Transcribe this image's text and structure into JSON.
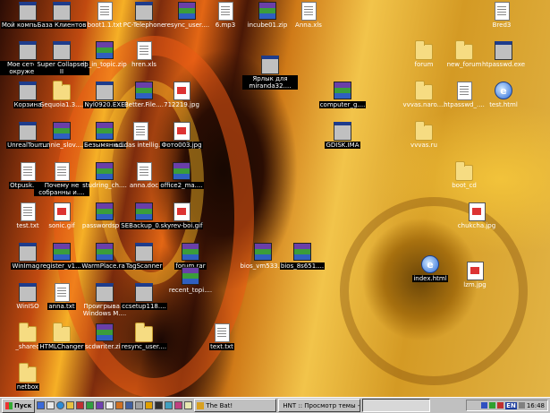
{
  "desktop": {
    "icons": [
      {
        "label": "Мой компьютер",
        "kind": "exe",
        "icon": "my-computer-icon"
      },
      {
        "label": "База Клиентов",
        "kind": "exe",
        "icon": "people-icon"
      },
      {
        "label": "boot1.1.txt",
        "kind": "doc",
        "icon": "text-file-icon"
      },
      {
        "label": "PC-Telephone",
        "kind": "exe",
        "icon": "phone-app-icon"
      },
      {
        "label": "resync_user....",
        "kind": "rar",
        "icon": "rar-archive-icon"
      },
      {
        "label": "6.mp3",
        "kind": "doc",
        "icon": "audio-file-icon"
      },
      {
        "label": "incube01.zip",
        "kind": "rar",
        "icon": "zip-archive-icon"
      },
      {
        "label": "Anna.xls",
        "kind": "doc",
        "icon": "excel-file-icon"
      },
      {
        "label": "Bred3",
        "kind": "doc",
        "icon": "document-icon"
      },
      {
        "label": "Мое сетевое окружение",
        "kind": "exe",
        "icon": "network-icon"
      },
      {
        "label": "Super Collapse! II",
        "kind": "exe",
        "icon": "game-icon"
      },
      {
        "label": "ip_in_topic.zip",
        "kind": "rar",
        "icon": "zip-archive-icon"
      },
      {
        "label": "hren.xls",
        "kind": "doc",
        "icon": "excel-file-icon"
      },
      {
        "label": "Ярлык для miranda32....",
        "kind": "exe",
        "icon": "miranda-shortcut-icon"
      },
      {
        "label": "forum",
        "kind": "folder",
        "icon": "folder-icon"
      },
      {
        "label": "new_forum",
        "kind": "folder",
        "icon": "folder-icon"
      },
      {
        "label": "htpasswd.exe",
        "kind": "exe",
        "icon": "executable-icon"
      },
      {
        "label": "Корзина",
        "kind": "exe",
        "icon": "recycle-bin-icon"
      },
      {
        "label": "Sequoia1.3....",
        "kind": "folder",
        "icon": "folder-icon"
      },
      {
        "label": "Nyl0920.EXE",
        "kind": "exe",
        "icon": "cd-executable-icon"
      },
      {
        "label": "Better.File....",
        "kind": "rar",
        "icon": "rar-archive-icon"
      },
      {
        "label": "712219.jpg",
        "kind": "img",
        "icon": "image-file-icon"
      },
      {
        "label": "computer_g....",
        "kind": "rar",
        "icon": "rar-archive-icon"
      },
      {
        "label": "vvvas.naro....",
        "kind": "folder",
        "icon": "folder-icon"
      },
      {
        "label": "htpasswd_....",
        "kind": "doc",
        "icon": "document-icon"
      },
      {
        "label": "test.html",
        "kind": "html",
        "icon": "html-file-icon"
      },
      {
        "label": "UnrealTour....",
        "kind": "exe",
        "icon": "game-icon"
      },
      {
        "label": "runnie_slov....",
        "kind": "rar",
        "icon": "rar-archive-icon"
      },
      {
        "label": "Безымянн....",
        "kind": "rar",
        "icon": "rar-archive-icon"
      },
      {
        "label": "adidas intellig....",
        "kind": "doc",
        "icon": "document-icon"
      },
      {
        "label": "Фото003.jpg",
        "kind": "img",
        "icon": "image-file-icon"
      },
      {
        "label": "GDISK.IMA",
        "kind": "exe",
        "icon": "disk-image-icon"
      },
      {
        "label": "vvvas.ru",
        "kind": "folder",
        "icon": "folder-icon"
      },
      {
        "label": "Otpusk.doc",
        "kind": "doc",
        "icon": "word-file-icon"
      },
      {
        "label": "Почему не собранны и....",
        "kind": "doc",
        "icon": "word-file-icon"
      },
      {
        "label": "studring_ch....",
        "kind": "rar",
        "icon": "rar-archive-icon"
      },
      {
        "label": "anna.doc",
        "kind": "doc",
        "icon": "word-file-icon"
      },
      {
        "label": "office2_ma....",
        "kind": "rar",
        "icon": "rar-archive-icon"
      },
      {
        "label": "boot_cd",
        "kind": "folder",
        "icon": "folder-icon"
      },
      {
        "label": "test.txt",
        "kind": "doc",
        "icon": "text-file-icon"
      },
      {
        "label": "sonic.gif",
        "kind": "img",
        "icon": "image-file-icon"
      },
      {
        "label": "passwordsp....",
        "kind": "rar",
        "icon": "rar-archive-icon"
      },
      {
        "label": "SEBackup_0....",
        "kind": "rar",
        "icon": "rar-archive-icon"
      },
      {
        "label": "skyrev-boi.gif",
        "kind": "img",
        "icon": "image-file-icon"
      },
      {
        "label": "chukcha.jpg",
        "kind": "img",
        "icon": "image-file-icon"
      },
      {
        "label": "WinImage",
        "kind": "exe",
        "icon": "winimage-icon"
      },
      {
        "label": "register_v1....",
        "kind": "rar",
        "icon": "rar-archive-icon"
      },
      {
        "label": "WarmPlace.rar",
        "kind": "rar",
        "icon": "rar-archive-icon"
      },
      {
        "label": "TagScanner",
        "kind": "exe",
        "icon": "magnifier-app-icon"
      },
      {
        "label": "forum.rar",
        "kind": "rar",
        "icon": "rar-archive-icon"
      },
      {
        "label": "bios_vm533....",
        "kind": "rar",
        "icon": "rar-archive-icon"
      },
      {
        "label": "bios_8s651....",
        "kind": "rar",
        "icon": "rar-archive-icon"
      },
      {
        "label": "index.html",
        "kind": "html",
        "icon": "html-file-icon"
      },
      {
        "label": "lzm.jpg",
        "kind": "img",
        "icon": "image-file-icon"
      },
      {
        "label": "WinISO",
        "kind": "exe",
        "icon": "winiso-icon"
      },
      {
        "label": "anna.txt",
        "kind": "doc",
        "icon": "text-file-icon"
      },
      {
        "label": "Проигрыва... Windows M....",
        "kind": "exe",
        "icon": "media-player-icon"
      },
      {
        "label": "ccsetup118....",
        "kind": "exe",
        "icon": "setup-icon"
      },
      {
        "label": "recent_topi....",
        "kind": "rar",
        "icon": "rar-archive-icon"
      },
      {
        "label": "_shared",
        "kind": "folder",
        "icon": "folder-icon"
      },
      {
        "label": "HTMLChanger",
        "kind": "folder",
        "icon": "folder-icon"
      },
      {
        "label": "scdwriter.zip",
        "kind": "rar",
        "icon": "zip-archive-icon"
      },
      {
        "label": "resync_user....",
        "kind": "folder",
        "icon": "folder-icon"
      },
      {
        "label": "text.txt",
        "kind": "doc",
        "icon": "text-file-icon"
      },
      {
        "label": "netbox",
        "kind": "folder",
        "icon": "folder-icon"
      }
    ]
  },
  "taskbar": {
    "start_label": "Пуск",
    "tasks": [
      {
        "label": "The Bat!",
        "active": false
      },
      {
        "label": "HNT :: Просмотр темы - ...",
        "active": false
      },
      {
        "label": "",
        "active": true
      }
    ],
    "language": "EN",
    "clock": "16:48"
  }
}
